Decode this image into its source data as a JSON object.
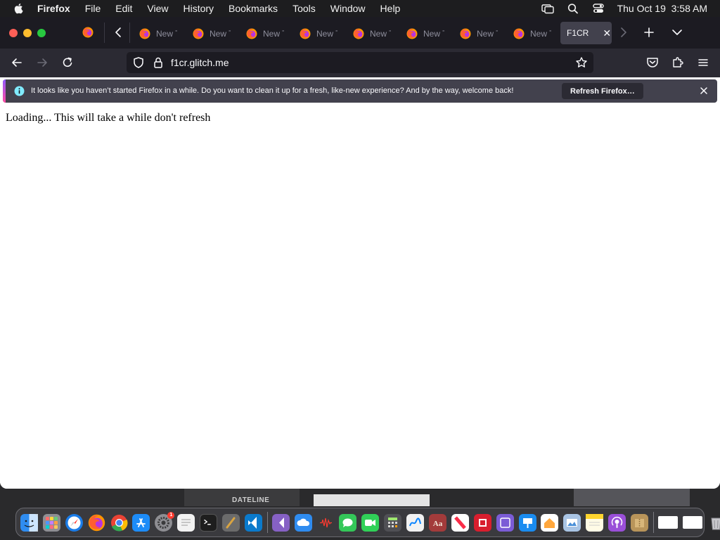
{
  "menubar": {
    "app_name": "Firefox",
    "items": [
      "File",
      "Edit",
      "View",
      "History",
      "Bookmarks",
      "Tools",
      "Window",
      "Help"
    ],
    "datetime": "Thu Oct 19  3:58 AM"
  },
  "tabs": {
    "items": [
      {
        "label": "New T"
      },
      {
        "label": "New T"
      },
      {
        "label": "New T"
      },
      {
        "label": "New T"
      },
      {
        "label": "New T"
      },
      {
        "label": "New T"
      },
      {
        "label": "New T"
      },
      {
        "label": "New T"
      }
    ],
    "active_label": "F1CR"
  },
  "navbar": {
    "url": "f1cr.glitch.me"
  },
  "infobar": {
    "message": "It looks like you haven’t started Firefox in a while. Do you want to clean it up for a fresh, like-new experience? And by the way, welcome back!",
    "button_label": "Refresh Firefox…"
  },
  "content": {
    "text": "Loading... This will take a while don't refresh"
  },
  "desktop": {
    "window_label": "DATELINE"
  },
  "dock": {
    "system_settings_badge": "1",
    "icons": [
      {
        "name": "finder",
        "color": "#2f8cf0"
      },
      {
        "name": "launchpad",
        "color": "#8e8e93"
      },
      {
        "name": "safari",
        "color": "#1a7ce8"
      },
      {
        "name": "firefox",
        "color": "#ff7139"
      },
      {
        "name": "chrome",
        "color": "#34a853"
      },
      {
        "name": "app-store",
        "color": "#1d8cf8"
      },
      {
        "name": "system-settings",
        "color": "#8e8e93"
      },
      {
        "name": "textedit",
        "color": "#f2f2f2"
      },
      {
        "name": "terminal",
        "color": "#1e1e1e"
      },
      {
        "name": "script-editor",
        "color": "#6b6b6b"
      },
      {
        "name": "vscode",
        "color": "#0a7acc"
      },
      {
        "name": "visual-studio",
        "color": "#8661c5"
      },
      {
        "name": "icloud-drive",
        "color": "#2f8cf0"
      },
      {
        "name": "voice-memos",
        "color": "#3a3a3c"
      },
      {
        "name": "messages",
        "color": "#34c759"
      },
      {
        "name": "facetime",
        "color": "#30d158"
      },
      {
        "name": "calculator",
        "color": "#505055"
      },
      {
        "name": "freeform",
        "color": "#f2f2f2"
      },
      {
        "name": "dictionary",
        "color": "#a33b3b"
      },
      {
        "name": "news",
        "color": "#fa2d48"
      },
      {
        "name": "photo-booth",
        "color": "#d81e2e"
      },
      {
        "name": "podcasts-purple",
        "color": "#7b5cd6"
      },
      {
        "name": "keynote",
        "color": "#1a8cf0"
      },
      {
        "name": "home",
        "color": "#ffa73d"
      },
      {
        "name": "preview",
        "color": "#a9c4e4"
      },
      {
        "name": "notes",
        "color": "#ffd52e"
      },
      {
        "name": "podcasts",
        "color": "#9a4fd8"
      },
      {
        "name": "archive-utility",
        "color": "#b8945a"
      }
    ]
  }
}
